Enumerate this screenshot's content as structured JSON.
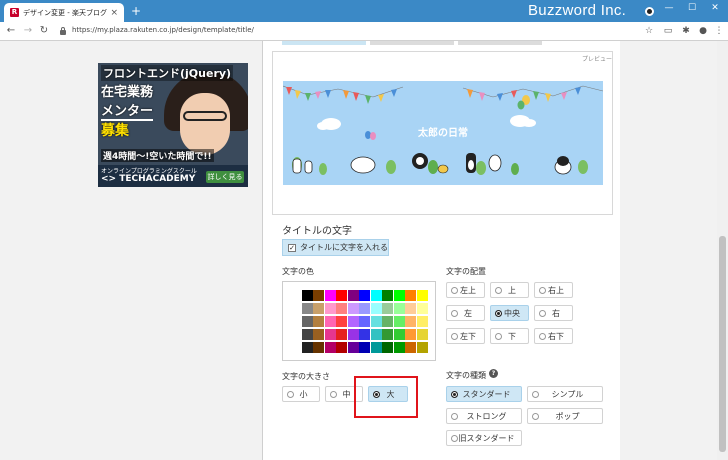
{
  "browser": {
    "tab_title": "デザイン変更 - 楽天ブログ",
    "favicon_letter": "R",
    "tab_close": "×",
    "new_tab": "+",
    "brand_overlay": "Buzzword Inc.",
    "url": "https://my.plaza.rakuten.co.jp/design/template/title/",
    "controls": {
      "minimize": "—",
      "maximize": "☐",
      "close": "✕"
    },
    "nav": {
      "back": "←",
      "forward": "→",
      "reload": "↻"
    },
    "toolbar_icons": [
      "star-icon",
      "screen-cast-icon",
      "extensions-icon",
      "account-icon",
      "menu-icon"
    ]
  },
  "ad": {
    "line1": "フロントエンド(jQuery)",
    "line2": "在宅業務",
    "line3": "メンター",
    "line4": "募集",
    "line5": "週4時間〜!空いた時間で!!",
    "sub": "オンラインプログラミングスクール",
    "logo": "<> TECHACADEMY",
    "cta": "詳しく見る >"
  },
  "preview": {
    "label": "プレビュー",
    "banner_title": "太郎の日常",
    "sky_color": "#a9d4f5"
  },
  "title_text": {
    "section_title": "タイトルの文字",
    "checkbox_label": "タイトルに文字を入れる",
    "checkbox_checked": true,
    "checkmark": "✓"
  },
  "color": {
    "label": "文字の色",
    "palette": [
      [
        "#ffffff",
        "#000000",
        "#7a3e00",
        "#ff00ff",
        "#ff0000",
        "#800080",
        "#0000ff",
        "#00ffff",
        "#008000",
        "#00ff00",
        "#ff8000",
        "#ffff00"
      ],
      [
        "#ffffff",
        "#888888",
        "#c8a06a",
        "#ff99cc",
        "#ff8080",
        "#cc99ff",
        "#9999ff",
        "#99ffff",
        "#99cc99",
        "#99ff99",
        "#ffcc99",
        "#ffff99"
      ],
      [
        "#ffffff",
        "#666666",
        "#b38040",
        "#ff66b3",
        "#ff4040",
        "#b366ff",
        "#6666ff",
        "#66e0e0",
        "#66b366",
        "#66ee66",
        "#ffb366",
        "#ffee66"
      ],
      [
        "#ffffff",
        "#444444",
        "#996020",
        "#e6368f",
        "#e62020",
        "#9933e6",
        "#3333e6",
        "#33c2c2",
        "#339933",
        "#33cc33",
        "#ff9933",
        "#e6d433"
      ],
      [
        "#ffffff",
        "#222222",
        "#663300",
        "#b30066",
        "#b30000",
        "#660099",
        "#0000b3",
        "#009999",
        "#006600",
        "#009900",
        "#cc6600",
        "#b3a300"
      ]
    ]
  },
  "position": {
    "label": "文字の配置",
    "options": [
      {
        "label": "左上",
        "selected": false
      },
      {
        "label": "上",
        "selected": false
      },
      {
        "label": "右上",
        "selected": false
      },
      {
        "label": "左",
        "selected": false
      },
      {
        "label": "中央",
        "selected": true
      },
      {
        "label": "右",
        "selected": false
      },
      {
        "label": "左下",
        "selected": false
      },
      {
        "label": "下",
        "selected": false
      },
      {
        "label": "右下",
        "selected": false
      }
    ]
  },
  "size": {
    "label": "文字の大きさ",
    "options": [
      {
        "label": "小",
        "selected": false
      },
      {
        "label": "中",
        "selected": false
      },
      {
        "label": "大",
        "selected": true
      }
    ],
    "highlight_color": "#e0141b"
  },
  "type": {
    "label": "文字の種類",
    "help": "?",
    "options": [
      {
        "label": "スタンダード",
        "selected": true
      },
      {
        "label": "シンプル",
        "selected": false
      },
      {
        "label": "ストロング",
        "selected": false
      },
      {
        "label": "ポップ",
        "selected": false
      },
      {
        "label": "旧スタンダード",
        "selected": false
      }
    ]
  }
}
